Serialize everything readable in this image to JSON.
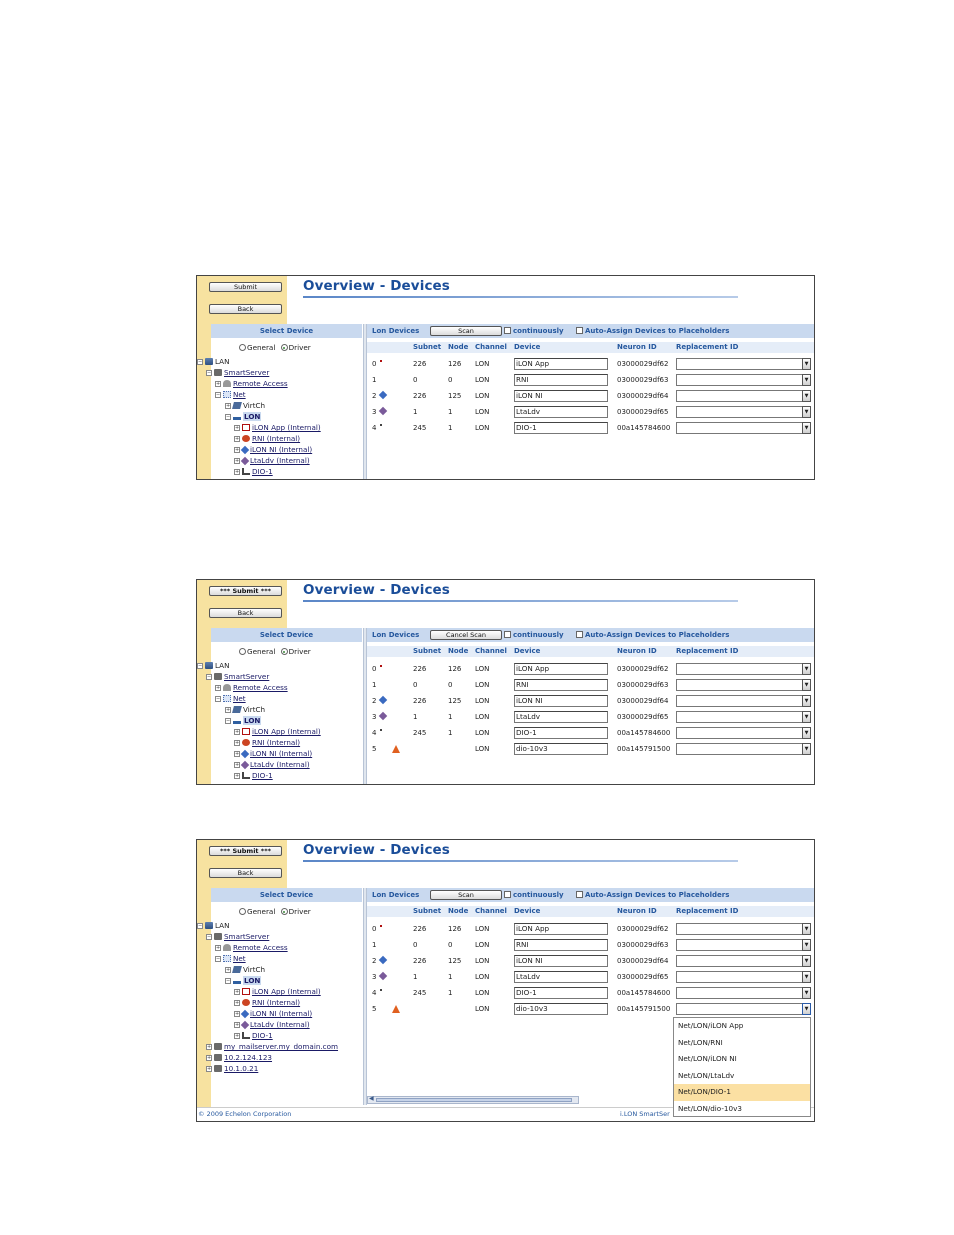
{
  "title": "Overview - Devices",
  "left_header": "Select Device",
  "radio_general": "General",
  "radio_driver": "Driver",
  "lon_devices_label": "Lon Devices",
  "continuously_label": "continuously",
  "auto_assign_label": "Auto-Assign Devices to Placeholders",
  "columns": {
    "subnet": "Subnet",
    "node": "Node",
    "channel": "Channel",
    "device": "Device",
    "neuron_id": "Neuron ID",
    "replacement_id": "Replacement ID"
  },
  "back_label": "Back",
  "panels": [
    {
      "submit_label": "Submit",
      "scan_label": "Scan",
      "tree": [
        "LAN",
        "SmartServer",
        "Remote Access",
        "Net",
        "VirtCh",
        "LON",
        "iLON App (Internal)",
        "RNI (Internal)",
        "iLON NI (Internal)",
        "LtaLdv (Internal)",
        "DIO-1"
      ],
      "rows": [
        {
          "idx": "0",
          "subnet": "226",
          "node": "126",
          "channel": "LON",
          "device": "iLON App",
          "neuron": "03000029df62"
        },
        {
          "idx": "1",
          "subnet": "0",
          "node": "0",
          "channel": "LON",
          "device": "RNI",
          "neuron": "03000029df63"
        },
        {
          "idx": "2",
          "subnet": "226",
          "node": "125",
          "channel": "LON",
          "device": "iLON NI",
          "neuron": "03000029df64"
        },
        {
          "idx": "3",
          "subnet": "1",
          "node": "1",
          "channel": "LON",
          "device": "LtaLdv",
          "neuron": "03000029df65"
        },
        {
          "idx": "4",
          "subnet": "245",
          "node": "1",
          "channel": "LON",
          "device": "DIO-1",
          "neuron": "00a145784600"
        }
      ]
    },
    {
      "submit_label": "*** Submit ***",
      "scan_label": "Cancel Scan",
      "tree": [
        "LAN",
        "SmartServer",
        "Remote Access",
        "Net",
        "VirtCh",
        "LON",
        "iLON App (Internal)",
        "RNI (Internal)",
        "iLON NI (Internal)",
        "LtaLdv (Internal)",
        "DIO-1"
      ],
      "rows": [
        {
          "idx": "0",
          "subnet": "226",
          "node": "126",
          "channel": "LON",
          "device": "iLON App",
          "neuron": "03000029df62"
        },
        {
          "idx": "1",
          "subnet": "0",
          "node": "0",
          "channel": "LON",
          "device": "RNI",
          "neuron": "03000029df63"
        },
        {
          "idx": "2",
          "subnet": "226",
          "node": "125",
          "channel": "LON",
          "device": "iLON NI",
          "neuron": "03000029df64"
        },
        {
          "idx": "3",
          "subnet": "1",
          "node": "1",
          "channel": "LON",
          "device": "LtaLdv",
          "neuron": "03000029df65"
        },
        {
          "idx": "4",
          "subnet": "245",
          "node": "1",
          "channel": "LON",
          "device": "DIO-1",
          "neuron": "00a145784600"
        },
        {
          "idx": "5",
          "subnet": "",
          "node": "",
          "channel": "LON",
          "device": "dio-10v3",
          "neuron": "00a145791500"
        }
      ]
    },
    {
      "submit_label": "*** Submit ***",
      "scan_label": "Scan",
      "tree": [
        "LAN",
        "SmartServer",
        "Remote Access",
        "Net",
        "VirtCh",
        "LON",
        "iLON App (Internal)",
        "RNI (Internal)",
        "iLON NI (Internal)",
        "LtaLdv (Internal)",
        "DIO-1",
        "my_mailserver.my_domain.com",
        "10.2.124.123",
        "10.1.0.21"
      ],
      "rows": [
        {
          "idx": "0",
          "subnet": "226",
          "node": "126",
          "channel": "LON",
          "device": "iLON App",
          "neuron": "03000029df62"
        },
        {
          "idx": "1",
          "subnet": "0",
          "node": "0",
          "channel": "LON",
          "device": "RNI",
          "neuron": "03000029df63"
        },
        {
          "idx": "2",
          "subnet": "226",
          "node": "125",
          "channel": "LON",
          "device": "iLON NI",
          "neuron": "03000029df64"
        },
        {
          "idx": "3",
          "subnet": "1",
          "node": "1",
          "channel": "LON",
          "device": "LtaLdv",
          "neuron": "03000029df65"
        },
        {
          "idx": "4",
          "subnet": "245",
          "node": "1",
          "channel": "LON",
          "device": "DIO-1",
          "neuron": "00a145784600"
        },
        {
          "idx": "5",
          "subnet": "",
          "node": "",
          "channel": "LON",
          "device": "dio-10v3",
          "neuron": "00a145791500"
        }
      ],
      "dropdown_options": [
        "Net/LON/iLON App",
        "Net/LON/RNI",
        "Net/LON/iLON NI",
        "Net/LON/LtaLdv",
        "Net/LON/DIO-1",
        "Net/LON/dio-10v3"
      ],
      "dropdown_highlighted": "Net/LON/DIO-1",
      "footer_left": "© 2009 Echelon Corporation",
      "footer_right": "i.LON SmartSer"
    }
  ],
  "colors": {
    "title": "#1a4d99",
    "header_bg": "#c9d9ef",
    "sidebar": "#f7e2a0",
    "highlight": "#fbe0a3"
  }
}
